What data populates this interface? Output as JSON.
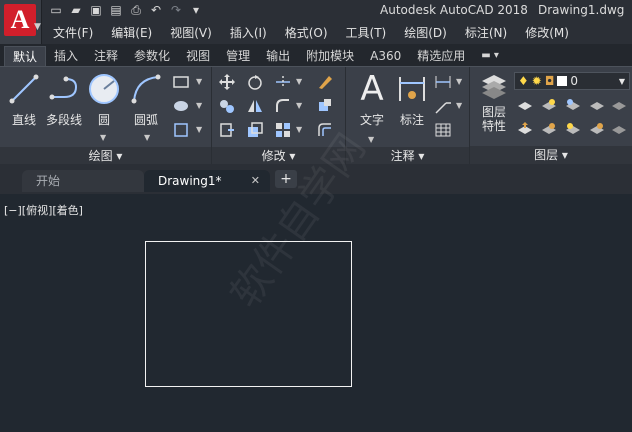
{
  "titlebar": {
    "app_name": "Autodesk AutoCAD 2018",
    "file_name": "Drawing1.dwg",
    "app_logo": "A",
    "qat_icons": [
      "new-file-icon",
      "open-folder-icon",
      "save-icon",
      "save-as-icon",
      "print-icon",
      "undo-icon",
      "redo-icon",
      "customize-dropdown-icon"
    ]
  },
  "menubar": {
    "items": [
      "文件(F)",
      "编辑(E)",
      "视图(V)",
      "插入(I)",
      "格式(O)",
      "工具(T)",
      "绘图(D)",
      "标注(N)",
      "修改(M)"
    ]
  },
  "ribbon_tabs": {
    "items": [
      "默认",
      "插入",
      "注释",
      "参数化",
      "视图",
      "管理",
      "输出",
      "附加模块",
      "A360",
      "精选应用"
    ],
    "active_index": 0
  },
  "panels": {
    "draw": {
      "title": "绘图",
      "tools": [
        "直线",
        "多段线",
        "圆",
        "圆弧"
      ]
    },
    "modify": {
      "title": "修改"
    },
    "annotation": {
      "title": "注释",
      "tools": [
        "文字",
        "标注"
      ]
    },
    "layers": {
      "title": "图层",
      "properties_label_line1": "图层",
      "properties_label_line2": "特性",
      "current_layer": "0"
    }
  },
  "doc_tabs": {
    "start": "开始",
    "drawing": "Drawing1*",
    "close_icon": "close-icon",
    "add_icon": "plus-icon"
  },
  "viewport": {
    "controls": "[−][俯视][着色]"
  },
  "watermark": {
    "text": "软件自学网"
  },
  "colors": {
    "app_red": "#d21f2b",
    "canvas": "#212830",
    "ribbon": "#3b4049",
    "line": "#f2f2f2"
  }
}
